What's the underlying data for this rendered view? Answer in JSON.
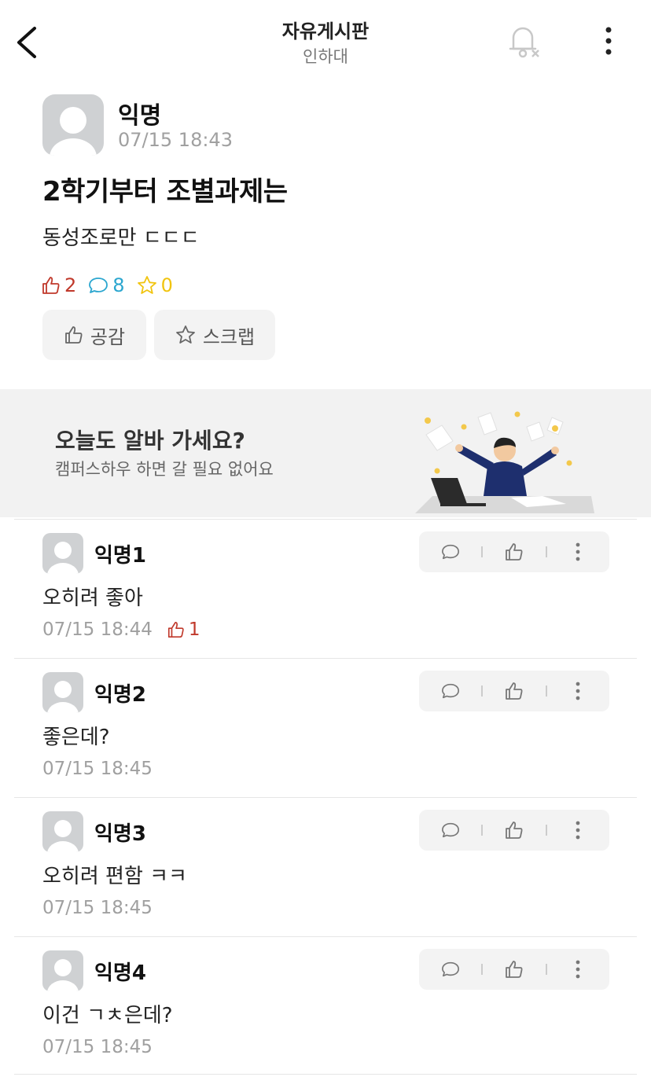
{
  "header": {
    "title": "자유게시판",
    "subtitle": "인하대",
    "icons": {
      "back": "chevron-left-icon",
      "bell": "bell-off-icon",
      "more": "more-vertical-icon"
    }
  },
  "post": {
    "author": "익명",
    "time": "07/15 18:43",
    "title": "2학기부터 조별과제는",
    "body": "동성조로만 ㄷㄷㄷ",
    "stats": {
      "likes": "2",
      "comments": "8",
      "scraps": "0"
    },
    "buttons": {
      "like_label": "공감",
      "scrap_label": "스크랩"
    }
  },
  "banner": {
    "title": "오늘도 알바 가세요?",
    "subtitle": "캠퍼스하우 하면 갈 필요 없어요"
  },
  "comments": [
    {
      "author": "익명1",
      "text": "오히려 좋아",
      "time": "07/15 18:44",
      "likes": "1"
    },
    {
      "author": "익명2",
      "text": "좋은데?",
      "time": "07/15 18:45"
    },
    {
      "author": "익명3",
      "text": "오히려 편함 ㅋㅋ",
      "time": "07/15 18:45"
    },
    {
      "author": "익명4",
      "text": "이건 ㄱㅊ은데?",
      "time": "07/15 18:45"
    }
  ],
  "colors": {
    "like": "#c0392b",
    "comment": "#2ba6cf",
    "scrap": "#f1c40f",
    "muted": "#a0a0a0"
  }
}
